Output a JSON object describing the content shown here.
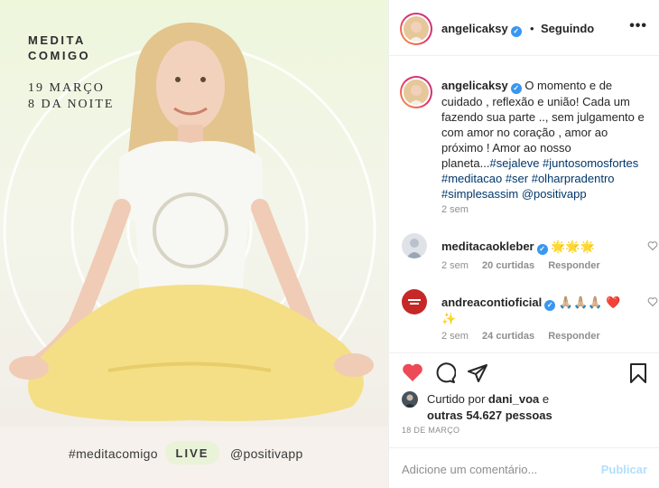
{
  "media": {
    "promo_title": "MEDITA\nCOMIGO",
    "promo_date": "19 MARÇO\n8 DA NOITE",
    "hashtag": "#meditacomigo",
    "live_label": "LIVE",
    "handle": "@positivapp"
  },
  "header": {
    "username": "angelicaksy",
    "separator": "•",
    "follow_status": "Seguindo",
    "more_icon": "more-icon"
  },
  "caption": {
    "username": "angelicaksy",
    "text_1": " O momento e de cuidado , reflexão e união! Cada um fazendo sua parte .., sem julgamento e com amor no coração , amor ao próximo ! Amor ao nosso planeta...",
    "tags_1": "#sejaleve #juntosomosfortes #meditacao #ser #olharpradentro #simplesassim @positivapp",
    "time": "2 sem"
  },
  "comments": [
    {
      "username": "meditacaokleber",
      "text": "🌟🌟🌟",
      "time": "2 sem",
      "likes": "20 curtidas",
      "reply": "Responder"
    },
    {
      "username": "andreacontioficial",
      "text": "🙏🏼🙏🏼🙏🏼 ❤️✨",
      "time": "2 sem",
      "likes": "24 curtidas",
      "reply": "Responder"
    }
  ],
  "actions": {
    "liked_prefix": "Curtido por ",
    "liked_user": "dani_voa",
    "liked_mid": " e ",
    "liked_count": "outras 54.627 pessoas",
    "date": "18 DE MARÇO"
  },
  "comment_box": {
    "placeholder": "Adicione um comentário...",
    "publish": "Publicar"
  },
  "colors": {
    "accent": "#3897f0",
    "heart_red": "#ed4956",
    "publish_disabled": "#b2dffc"
  }
}
